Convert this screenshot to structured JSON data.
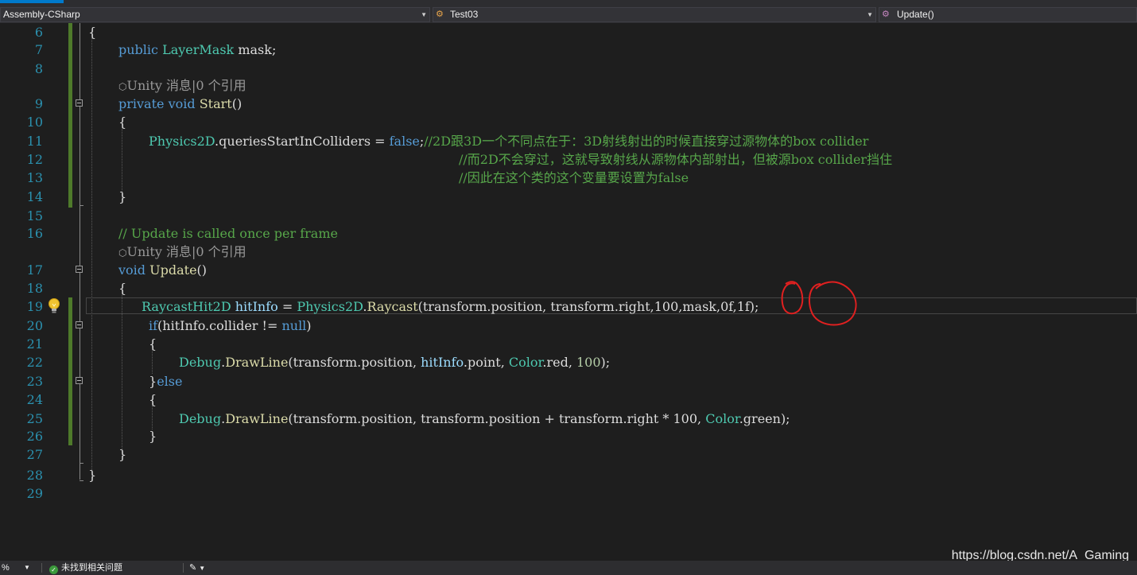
{
  "colors": {
    "background": "#1e1e1e",
    "line_number": "#2b91af",
    "keyword": "#569cd6",
    "type": "#4ec9b0",
    "method": "#dcdcaa",
    "comment": "#57a64a",
    "variable": "#9cdcfe",
    "number": "#b5cea8",
    "change_bar": "#4e7a2a",
    "annotation": "#e02020"
  },
  "navbar": {
    "project": "Assembly-CSharp",
    "class": "Test03",
    "member": "Update()",
    "class_icon": "class-icon",
    "member_icon": "method-icon"
  },
  "codelens": {
    "text": "Unity 消息|0 个引用"
  },
  "lines": {
    "l6": {
      "num": "6",
      "brace": "{"
    },
    "l7": {
      "num": "7",
      "kw": "public",
      "type": "LayerMask",
      "rest": "mask;"
    },
    "l8": {
      "num": "8"
    },
    "l9": {
      "num": "9",
      "kw1": "private",
      "kw2": "void",
      "method": "Start",
      "rest": "()"
    },
    "l10": {
      "num": "10",
      "brace": "{"
    },
    "l11": {
      "num": "11",
      "type": "Physics2D",
      "dot": ".",
      "prop": "queriesStartInColliders",
      "eq": " = ",
      "val": "false",
      "semi": ";",
      "comment": "//2D跟3D一个不同点在于：3D射线射出的时候直接穿过源物体的box collider"
    },
    "l12": {
      "num": "12",
      "comment": "//而2D不会穿过，这就导致射线从源物体内部射出，但被源box collider挡住"
    },
    "l13": {
      "num": "13",
      "comment": "//因此在这个类的这个变量要设置为false"
    },
    "l14": {
      "num": "14",
      "brace": "}"
    },
    "l15": {
      "num": "15"
    },
    "l16": {
      "num": "16",
      "comment": "// Update is called once per frame"
    },
    "l17": {
      "num": "17",
      "kw": "void",
      "method": "Update",
      "rest": "()"
    },
    "l18": {
      "num": "18",
      "brace": "{"
    },
    "l19": {
      "num": "19",
      "type1": "RaycastHit2D",
      "var": "hitInfo",
      "eq": " = ",
      "type2": "Physics2D",
      "dot": ".",
      "method": "Raycast",
      "rest": "(transform.position, transform.right,100,mask,0f,1f);"
    },
    "l20": {
      "num": "20",
      "kw": "if",
      "open": "(",
      "var": "hitInfo",
      "mid": ".collider != ",
      "val": "null",
      "close": ")"
    },
    "l21": {
      "num": "21",
      "brace": "{"
    },
    "l22": {
      "num": "22",
      "type1": "Debug",
      "dot": ".",
      "method": "DrawLine",
      "a": "(transform.position, ",
      "var": "hitInfo",
      "b": ".point, ",
      "type2": "Color",
      "c": ".red, ",
      "num100": "100",
      "end": ");"
    },
    "l23": {
      "num": "23",
      "brace": "}",
      "kw": "else"
    },
    "l24": {
      "num": "24",
      "brace": "{"
    },
    "l25": {
      "num": "25",
      "type1": "Debug",
      "dot": ".",
      "method": "DrawLine",
      "a": "(transform.position, transform.position + transform.right ",
      "star": "*",
      "b": " 100, ",
      "type2": "Color",
      "c": ".green);"
    },
    "l26": {
      "num": "26",
      "brace": "}"
    },
    "l27": {
      "num": "27",
      "brace": "}"
    },
    "l28": {
      "num": "28",
      "brace": "}"
    },
    "l29": {
      "num": "29"
    }
  },
  "statusbar": {
    "zoom": "%",
    "issues": "未找到相关问题",
    "brush_icon": "brush-icon"
  },
  "watermark": "https://blog.csdn.net/A_Gaming"
}
